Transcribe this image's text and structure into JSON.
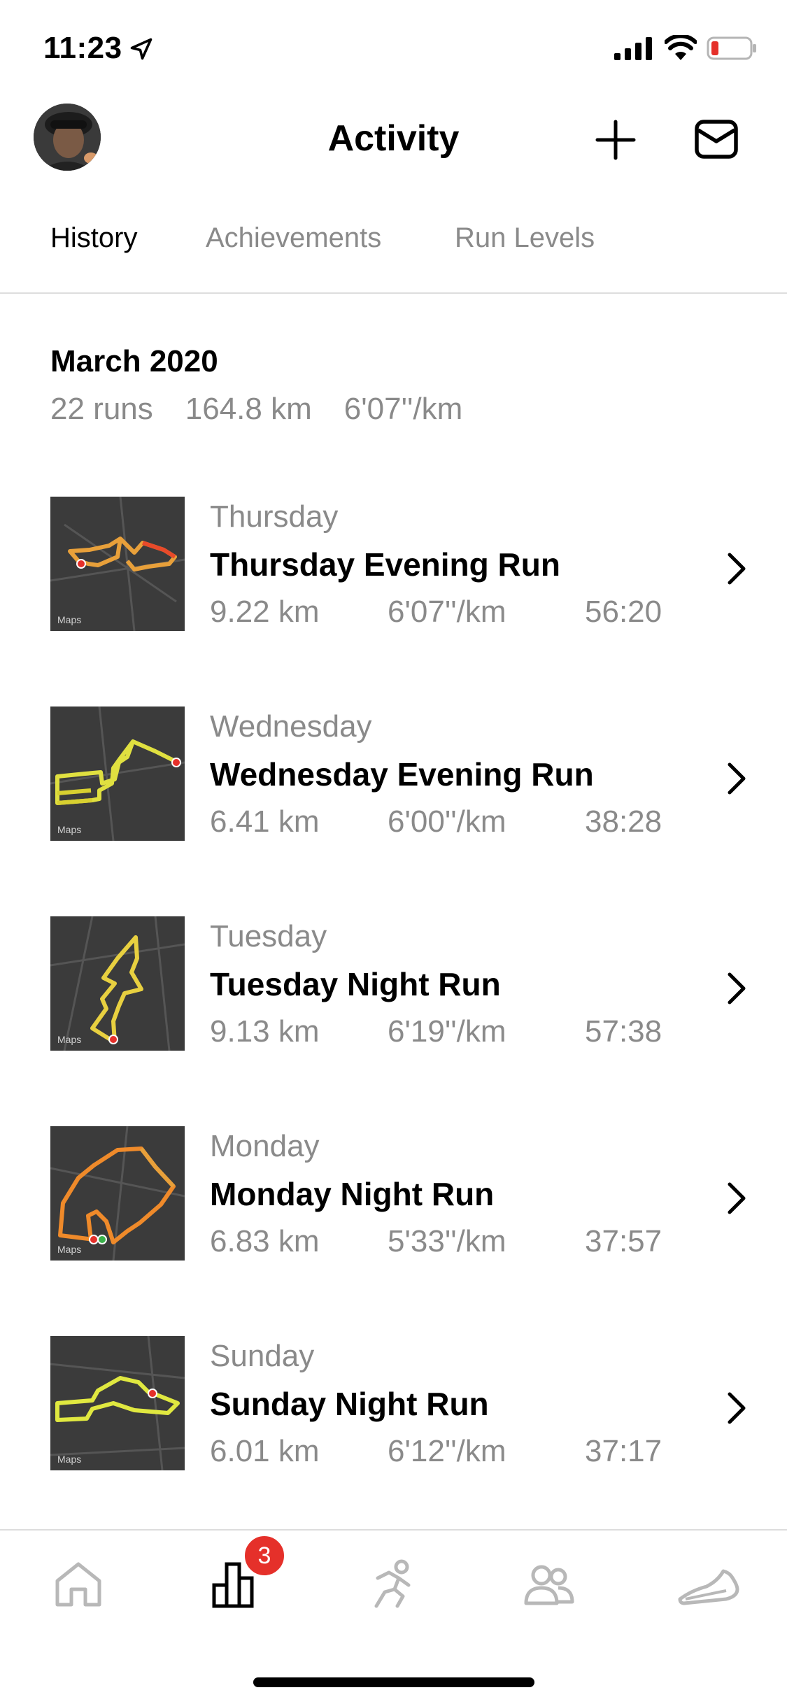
{
  "status_bar": {
    "time": "11:23"
  },
  "header": {
    "title": "Activity"
  },
  "tabs": [
    {
      "label": "History",
      "active": true
    },
    {
      "label": "Achievements",
      "active": false
    },
    {
      "label": "Run Levels",
      "active": false
    }
  ],
  "summary": {
    "month": "March 2020",
    "runs": "22 runs",
    "distance": "164.8 km",
    "pace": "6'07''/km"
  },
  "map_label": "Maps",
  "runs": [
    {
      "day": "Thursday",
      "name": "Thursday Evening Run",
      "distance": "9.22 km",
      "pace": "6'07''/km",
      "duration": "56:20"
    },
    {
      "day": "Wednesday",
      "name": "Wednesday Evening Run",
      "distance": "6.41 km",
      "pace": "6'00''/km",
      "duration": "38:28"
    },
    {
      "day": "Tuesday",
      "name": "Tuesday Night Run",
      "distance": "9.13 km",
      "pace": "6'19''/km",
      "duration": "57:38"
    },
    {
      "day": "Monday",
      "name": "Monday Night Run",
      "distance": "6.83 km",
      "pace": "5'33''/km",
      "duration": "37:57"
    },
    {
      "day": "Sunday",
      "name": "Sunday Night Run",
      "distance": "6.01 km",
      "pace": "6'12''/km",
      "duration": "37:17"
    }
  ],
  "nav": {
    "badge_count": "3",
    "items": [
      {
        "icon": "home-icon",
        "active": false
      },
      {
        "icon": "activity-icon",
        "active": true
      },
      {
        "icon": "run-icon",
        "active": false
      },
      {
        "icon": "club-icon",
        "active": false
      },
      {
        "icon": "shoe-icon",
        "active": false
      }
    ]
  },
  "colors": {
    "accent_badge": "#e5302a",
    "muted_text": "#8a8a8a",
    "route_yellow": "#e8e84a",
    "route_orange": "#ef8a2a"
  }
}
